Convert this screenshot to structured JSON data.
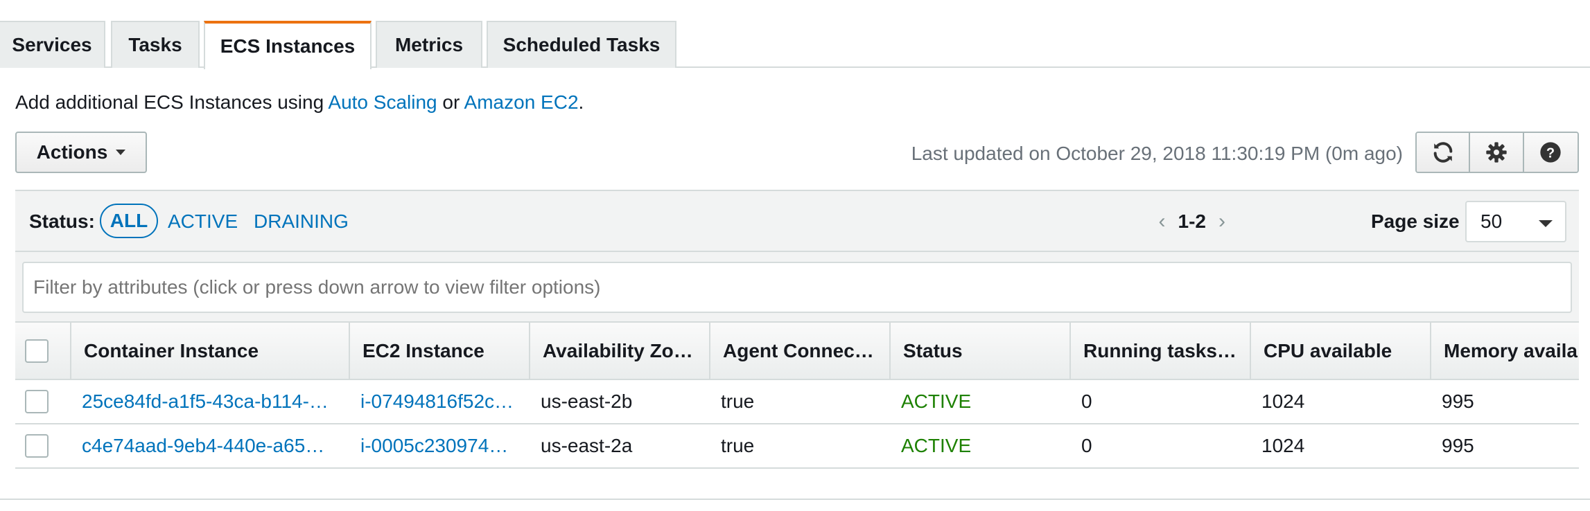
{
  "tabs": [
    "Services",
    "Tasks",
    "ECS Instances",
    "Metrics",
    "Scheduled Tasks"
  ],
  "intro": {
    "prefix": "Add additional ECS Instances using ",
    "link1": "Auto Scaling",
    "middle": " or ",
    "link2": "Amazon EC2",
    "suffix": "."
  },
  "toolbar": {
    "actions_label": "Actions",
    "last_updated": "Last updated on October 29, 2018 11:30:19 PM (0m ago)",
    "icons": [
      "refresh-icon",
      "gear-icon",
      "help-icon"
    ]
  },
  "status_filter": {
    "label": "Status:",
    "options": [
      "ALL",
      "ACTIVE",
      "DRAINING"
    ],
    "selected": "ALL"
  },
  "pagination": {
    "range": "1-2",
    "page_size_label": "Page size",
    "page_size": "50"
  },
  "filter": {
    "placeholder": "Filter by attributes (click or press down arrow to view filter options)"
  },
  "table": {
    "headers": [
      "Container Instance",
      "EC2 Instance",
      "Availability Zo…",
      "Agent Connec…",
      "Status",
      "Running tasks…",
      "CPU available",
      "Memory availa"
    ],
    "rows": [
      [
        "25ce84fd-a1f5-43ca-b114-…",
        "i-07494816f52c…",
        "us-east-2b",
        "true",
        "ACTIVE",
        "0",
        "1024",
        "995"
      ],
      [
        "c4e74aad-9eb4-440e-a65…",
        "i-0005c230974…",
        "us-east-2a",
        "true",
        "ACTIVE",
        "0",
        "1024",
        "995"
      ]
    ]
  },
  "colors": {
    "accent": "#ec7211",
    "link": "#0073bb",
    "active": "#1d8102"
  }
}
